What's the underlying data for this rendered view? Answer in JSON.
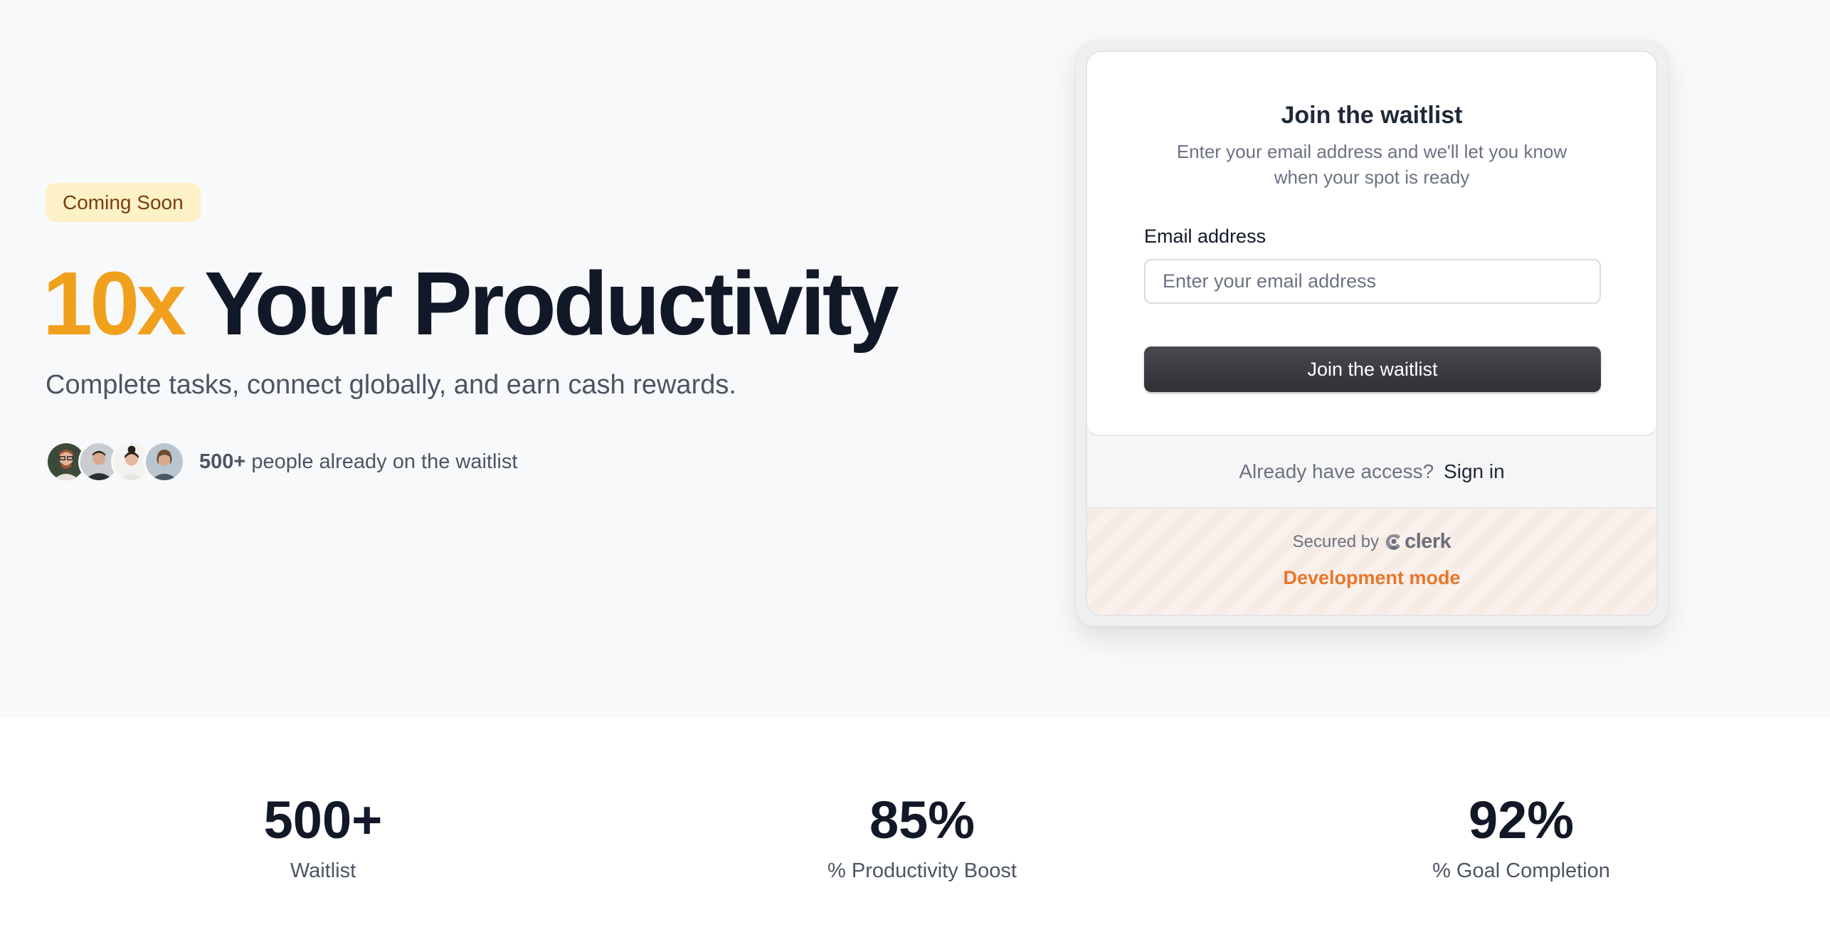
{
  "hero": {
    "badge": "Coming Soon",
    "headline_accent": "10x",
    "headline_rest": "Your Productivity",
    "subhead": "Complete tasks, connect globally, and earn cash rewards.",
    "social_count": "500+",
    "social_text": "people already on the waitlist",
    "accent_color": "#f0a01c"
  },
  "card": {
    "title": "Join the waitlist",
    "description": "Enter your email address and we'll let you know when your spot is ready",
    "email_label": "Email address",
    "email_placeholder": "Enter your email address",
    "email_value": "",
    "submit_label": "Join the waitlist",
    "access_text": "Already have access?",
    "signin_label": "Sign in",
    "secured_by": "Secured by",
    "brand": "clerk",
    "dev_mode": "Development mode",
    "dev_color": "#e8762b"
  },
  "stats": [
    {
      "value": "500+",
      "label": "Waitlist"
    },
    {
      "value": "85%",
      "label": "% Productivity Boost"
    },
    {
      "value": "92%",
      "label": "% Goal Completion"
    }
  ]
}
